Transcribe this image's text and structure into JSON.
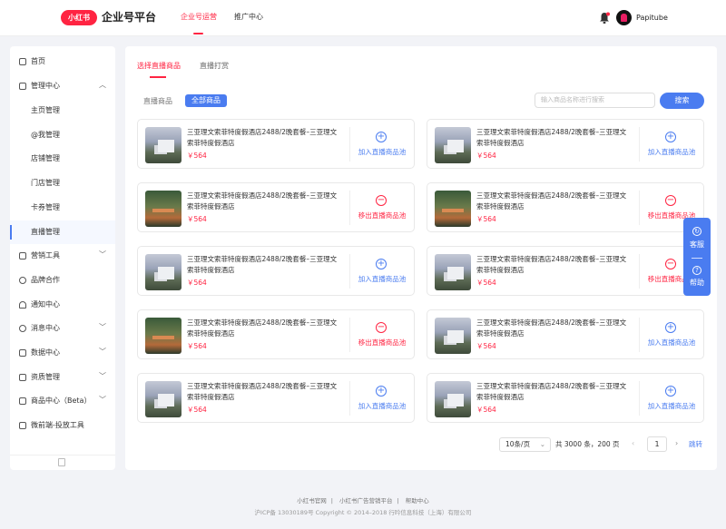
{
  "header": {
    "logo_text": "小红书",
    "brand": "企业号平台",
    "nav": [
      {
        "label": "企业号运营",
        "active": true
      },
      {
        "label": "推广中心",
        "active": false
      }
    ],
    "username": "Papitube"
  },
  "sidebar": {
    "items": [
      {
        "label": "首页",
        "icon": "grid-icon"
      },
      {
        "label": "管理中心",
        "icon": "calendar-icon",
        "expanded": true
      },
      {
        "label": "营销工具",
        "icon": "bag-icon"
      },
      {
        "label": "品牌合作",
        "icon": "heart-icon"
      },
      {
        "label": "通知中心",
        "icon": "bell-icon"
      },
      {
        "label": "消息中心",
        "icon": "chat-icon"
      },
      {
        "label": "数据中心",
        "icon": "chart-icon"
      },
      {
        "label": "资质管理",
        "icon": "badge-icon"
      },
      {
        "label": "商品中心（Beta）",
        "icon": "grid-icon"
      },
      {
        "label": "微前端-投放工具",
        "icon": "grid-icon"
      }
    ],
    "subitems": [
      "主页管理",
      "@我管理",
      "店铺管理",
      "门店管理",
      "卡券管理",
      "直播管理"
    ],
    "active_subitem": "直播管理"
  },
  "tabs": [
    {
      "label": "选择直播商品",
      "active": true
    },
    {
      "label": "直播打赏",
      "active": false
    }
  ],
  "filter": {
    "label": "直播商品",
    "chip": "全部商品"
  },
  "search": {
    "placeholder": "输入商品名称进行搜索",
    "button": "搜索"
  },
  "product_title": "三亚理文索菲特度假酒店2488/2晚套餐–三亚理文索菲特度假酒店",
  "product_price": "￥564",
  "actions": {
    "add": "加入直播商品池",
    "remove": "移出直播商品池"
  },
  "cards": [
    {
      "thumb": "house",
      "action": "add"
    },
    {
      "thumb": "house",
      "action": "add"
    },
    {
      "thumb": "tree",
      "action": "remove"
    },
    {
      "thumb": "tree",
      "action": "remove"
    },
    {
      "thumb": "house",
      "action": "add"
    },
    {
      "thumb": "house",
      "action": "remove"
    },
    {
      "thumb": "tree",
      "action": "remove"
    },
    {
      "thumb": "house",
      "action": "add"
    },
    {
      "thumb": "house",
      "action": "add"
    },
    {
      "thumb": "house",
      "action": "add"
    }
  ],
  "pagination": {
    "page_size": "10条/页",
    "total": "共 3000 条，200 页",
    "current": "1",
    "jump": "跳转"
  },
  "float": {
    "service": "客服",
    "help": "帮助"
  },
  "footer": {
    "links": [
      "小红书官网",
      "小红书广告营销平台",
      "帮助中心"
    ],
    "copyright": "沪ICP备 13030189号 Copyright © 2014–2018 行吟信息科技（上海）有限公司"
  },
  "colors": {
    "accent": "#ff2442",
    "primary": "#4a7cf0"
  }
}
